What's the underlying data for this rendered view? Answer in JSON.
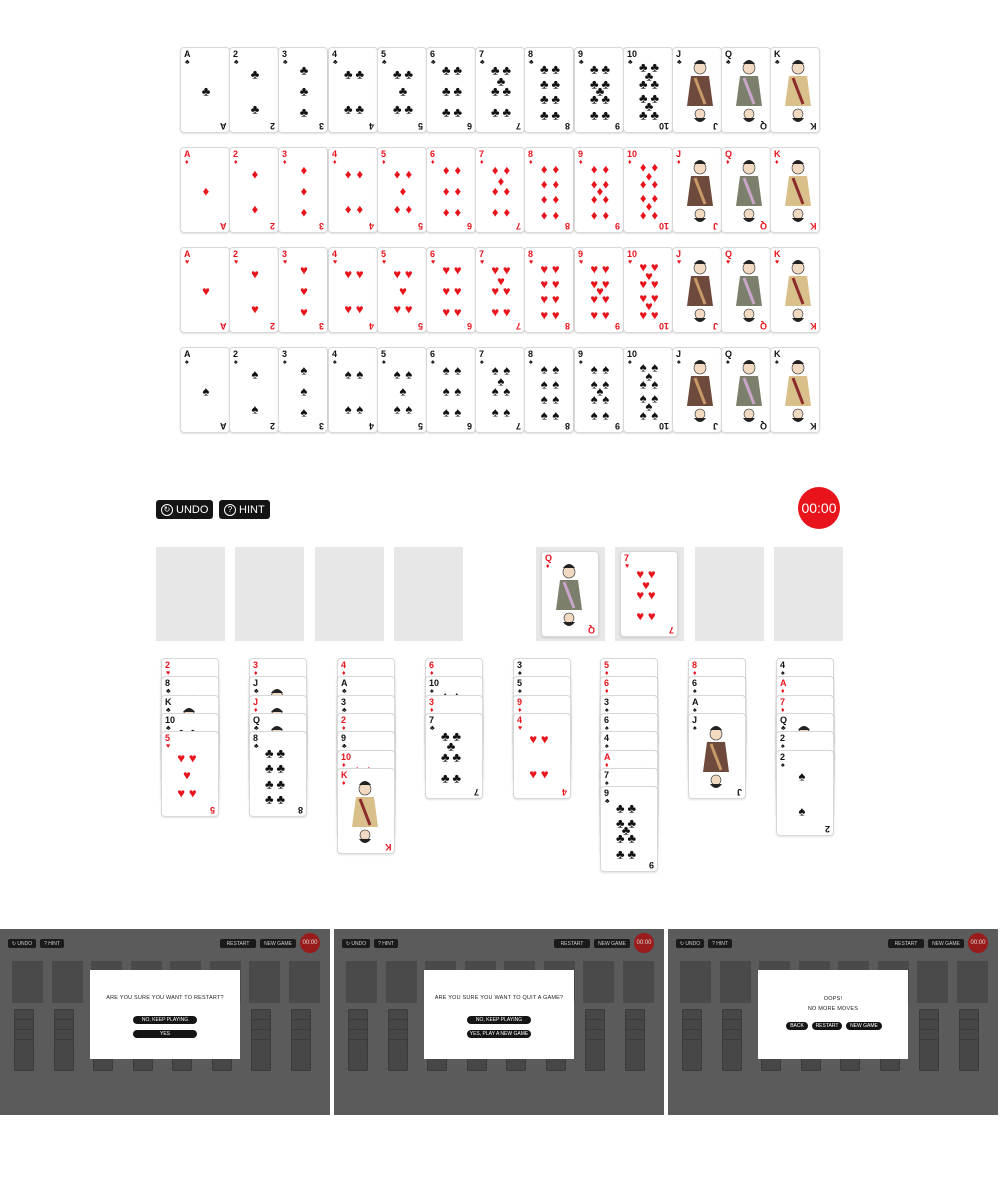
{
  "deck_rows": [
    {
      "suit": "clubs",
      "symbol": "♣",
      "color": "black",
      "ranks": [
        "A",
        "2",
        "3",
        "4",
        "5",
        "6",
        "7",
        "8",
        "9",
        "10",
        "J",
        "Q",
        "K"
      ]
    },
    {
      "suit": "diamonds",
      "symbol": "♦",
      "color": "red",
      "ranks": [
        "A",
        "2",
        "3",
        "4",
        "5",
        "6",
        "7",
        "8",
        "9",
        "10",
        "J",
        "Q",
        "K"
      ]
    },
    {
      "suit": "hearts",
      "symbol": "♥",
      "color": "red",
      "ranks": [
        "A",
        "2",
        "3",
        "4",
        "5",
        "6",
        "7",
        "8",
        "9",
        "10",
        "J",
        "Q",
        "K"
      ]
    },
    {
      "suit": "spades",
      "symbol": "♠",
      "color": "black",
      "ranks": [
        "A",
        "2",
        "3",
        "4",
        "5",
        "6",
        "7",
        "8",
        "9",
        "10",
        "J",
        "Q",
        "K"
      ]
    }
  ],
  "toolbar": {
    "undo_label": "UNDO",
    "hint_label": "HINT",
    "timer": "00:00"
  },
  "top_slots": {
    "freecells": [
      null,
      null,
      null,
      null
    ],
    "foundations": [
      {
        "rank": "Q",
        "symbol": "♦",
        "color": "red"
      },
      {
        "rank": "7",
        "symbol": "♥",
        "color": "red"
      },
      null,
      null
    ]
  },
  "tableau": [
    [
      [
        "2",
        "♥",
        "red"
      ],
      [
        "8",
        "♣",
        "black"
      ],
      [
        "K",
        "♣",
        "black"
      ],
      [
        "10",
        "♣",
        "black"
      ],
      [
        "5",
        "♥",
        "red"
      ]
    ],
    [
      [
        "3",
        "♦",
        "red"
      ],
      [
        "J",
        "♣",
        "black"
      ],
      [
        "J",
        "♦",
        "red"
      ],
      [
        "Q",
        "♣",
        "black"
      ],
      [
        "8",
        "♣",
        "black"
      ]
    ],
    [
      [
        "4",
        "♦",
        "red"
      ],
      [
        "A",
        "♣",
        "black"
      ],
      [
        "3",
        "♣",
        "black"
      ],
      [
        "2",
        "♦",
        "red"
      ],
      [
        "9",
        "♣",
        "black"
      ],
      [
        "10",
        "♦",
        "red"
      ],
      [
        "K",
        "♦",
        "red"
      ]
    ],
    [
      [
        "6",
        "♦",
        "red"
      ],
      [
        "10",
        "♠",
        "black"
      ],
      [
        "3",
        "♦",
        "red"
      ],
      [
        "7",
        "♣",
        "black"
      ]
    ],
    [
      [
        "3",
        "♠",
        "black"
      ],
      [
        "5",
        "♠",
        "black"
      ],
      [
        "9",
        "♦",
        "red"
      ],
      [
        "4",
        "♥",
        "red"
      ]
    ],
    [
      [
        "5",
        "♦",
        "red"
      ],
      [
        "6",
        "♦",
        "red"
      ],
      [
        "3",
        "♠",
        "black"
      ],
      [
        "6",
        "♠",
        "black"
      ],
      [
        "4",
        "♠",
        "black"
      ],
      [
        "A",
        "♦",
        "red"
      ],
      [
        "7",
        "♠",
        "black"
      ],
      [
        "9",
        "♣",
        "black"
      ]
    ],
    [
      [
        "8",
        "♦",
        "red"
      ],
      [
        "6",
        "♠",
        "black"
      ],
      [
        "A",
        "♠",
        "black"
      ],
      [
        "J",
        "♠",
        "black"
      ]
    ],
    [
      [
        "4",
        "♠",
        "black"
      ],
      [
        "A",
        "♦",
        "red"
      ],
      [
        "7",
        "♦",
        "red"
      ],
      [
        "Q",
        "♣",
        "black"
      ],
      [
        "2",
        "♠",
        "black"
      ],
      [
        "2",
        "♠",
        "black"
      ]
    ]
  ],
  "overlays": [
    {
      "top": {
        "undo": "UNDO",
        "hint": "HINT",
        "restart": "RESTART",
        "new_game": "NEW GAME",
        "timer": "00:00"
      },
      "title": "ARE YOU SURE YOU WANT TO RESTART?",
      "subtitle": "",
      "buttons": [
        "NO, KEEP PLAYING",
        "YES"
      ]
    },
    {
      "top": {
        "undo": "UNDO",
        "hint": "HINT",
        "restart": "RESTART",
        "new_game": "NEW GAME",
        "timer": "00:00"
      },
      "title": "ARE YOU SURE YOU WANT TO QUIT A GAME?",
      "subtitle": "",
      "buttons": [
        "NO, KEEP PLAYING",
        "YES, PLAY A NEW GAME"
      ]
    },
    {
      "top": {
        "undo": "UNDO",
        "hint": "HINT",
        "restart": "RESTART",
        "new_game": "NEW GAME",
        "timer": "00:00"
      },
      "title": "OOPS!",
      "subtitle": "NO MORE MOVES",
      "buttons": [
        "BACK",
        "RESTART",
        "NEW GAME"
      ]
    }
  ],
  "icons": {
    "undo": "undo-arrow-icon",
    "hint": "question-circle-icon"
  }
}
